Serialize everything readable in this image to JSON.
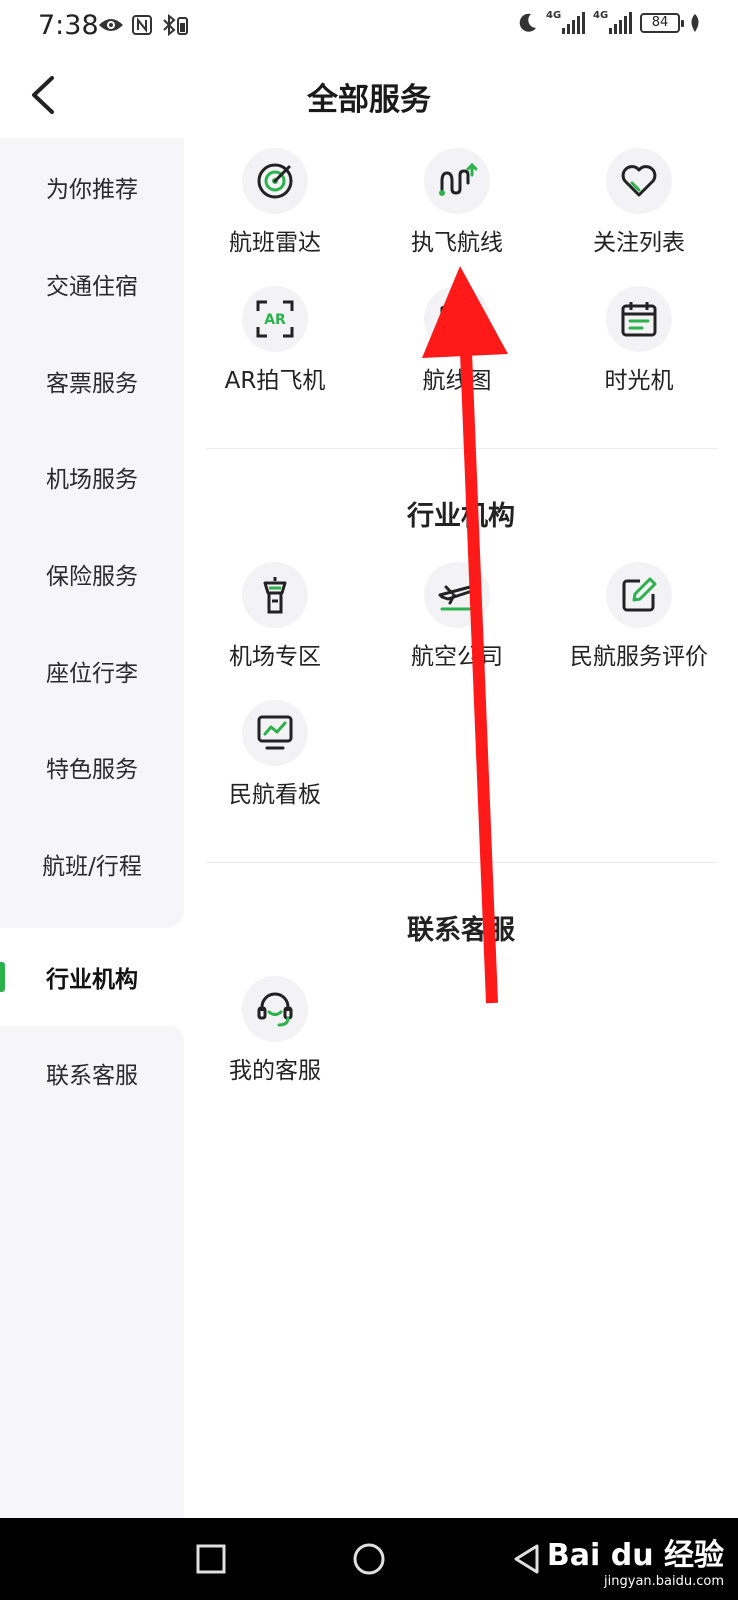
{
  "status_bar": {
    "time": "7:38",
    "network_1": "4G",
    "network_2": "4G",
    "battery": "84"
  },
  "header": {
    "title": "全部服务"
  },
  "sidebar": {
    "items": [
      {
        "label": "为你推荐"
      },
      {
        "label": "交通住宿"
      },
      {
        "label": "客票服务"
      },
      {
        "label": "机场服务"
      },
      {
        "label": "保险服务"
      },
      {
        "label": "座位行李"
      },
      {
        "label": "特色服务"
      },
      {
        "label": "航班/行程"
      },
      {
        "label": "行业机构",
        "active": true
      },
      {
        "label": "联系客服"
      }
    ]
  },
  "sections": {
    "recommended": {
      "items": [
        {
          "label": "航班雷达",
          "icon": "radar-icon"
        },
        {
          "label": "执飞航线",
          "icon": "route-icon"
        },
        {
          "label": "关注列表",
          "icon": "heart-icon"
        },
        {
          "label": "AR拍飞机",
          "icon": "ar-icon",
          "icon_text": "AR"
        },
        {
          "label": "航线图",
          "icon": "map-icon"
        },
        {
          "label": "时光机",
          "icon": "calendar-icon"
        }
      ]
    },
    "industry": {
      "title": "行业机构",
      "items": [
        {
          "label": "机场专区",
          "icon": "control-tower-icon"
        },
        {
          "label": "航空公司",
          "icon": "airplane-icon"
        },
        {
          "label": "民航服务评价",
          "icon": "edit-icon"
        },
        {
          "label": "民航看板",
          "icon": "dashboard-icon"
        }
      ]
    },
    "contact": {
      "title": "联系客服",
      "items": [
        {
          "label": "我的客服",
          "icon": "headset-icon"
        }
      ]
    }
  },
  "watermark": {
    "logo": "Bai du 经验",
    "sub": "jingyan.baidu.com"
  },
  "colors": {
    "accent": "#2bb24c",
    "arrow": "#ff1a1a"
  }
}
